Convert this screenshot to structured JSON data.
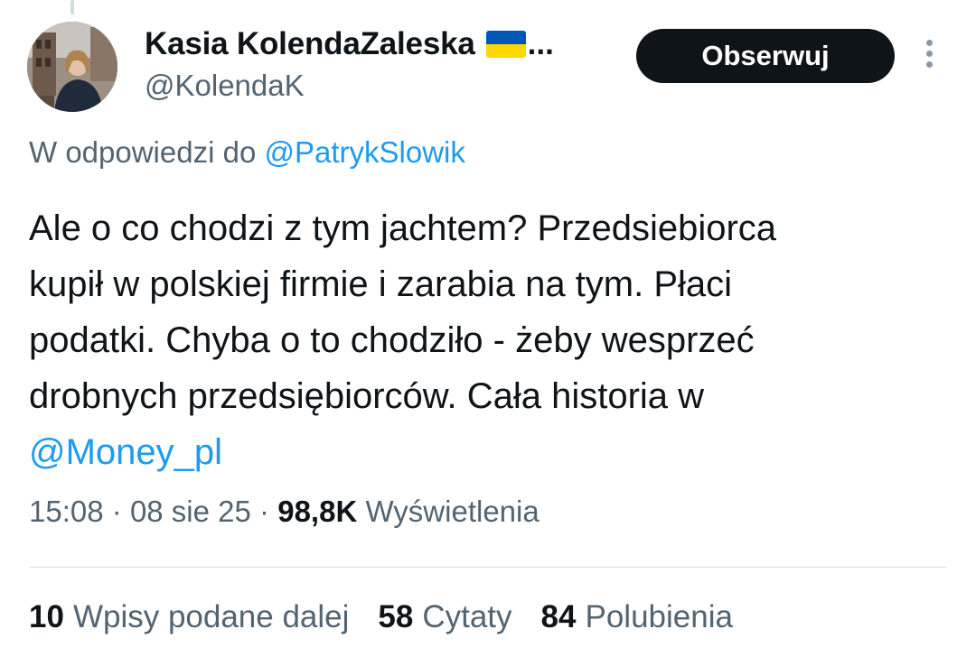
{
  "author": {
    "display_name": "Kasia KolendaZaleska",
    "ellipsis": "...",
    "handle": "@KolendaK",
    "flag_colors": {
      "top": "#0057b7",
      "bottom": "#ffd700"
    }
  },
  "follow_button_label": "Obserwuj",
  "reply_to": {
    "prefix": "W odpowiedzi do",
    "mention": "@PatrykSlowik"
  },
  "tweet": {
    "lines": [
      "Ale o co chodzi z tym jachtem? Przedsiebiorca",
      "kupił w polskiej firmie i zarabia na tym. Płaci",
      "podatki. Chyba o to chodziło - żeby wesprzeć",
      "drobnych przedsiębiorców. Cała historia w"
    ],
    "mention": "@Money_pl"
  },
  "meta": {
    "time": "15:08",
    "separator": "·",
    "date": "08 sie 25",
    "views_count": "98,8K",
    "views_label": "Wyświetlenia"
  },
  "stats": [
    {
      "count": "10",
      "label": "Wpisy podane dalej"
    },
    {
      "count": "58",
      "label": "Cytaty"
    },
    {
      "count": "84",
      "label": "Polubienia"
    }
  ],
  "colors": {
    "accent": "#1d9bf0",
    "text_primary": "#0f1419",
    "text_secondary": "#536471",
    "button_bg": "#0f1419"
  }
}
